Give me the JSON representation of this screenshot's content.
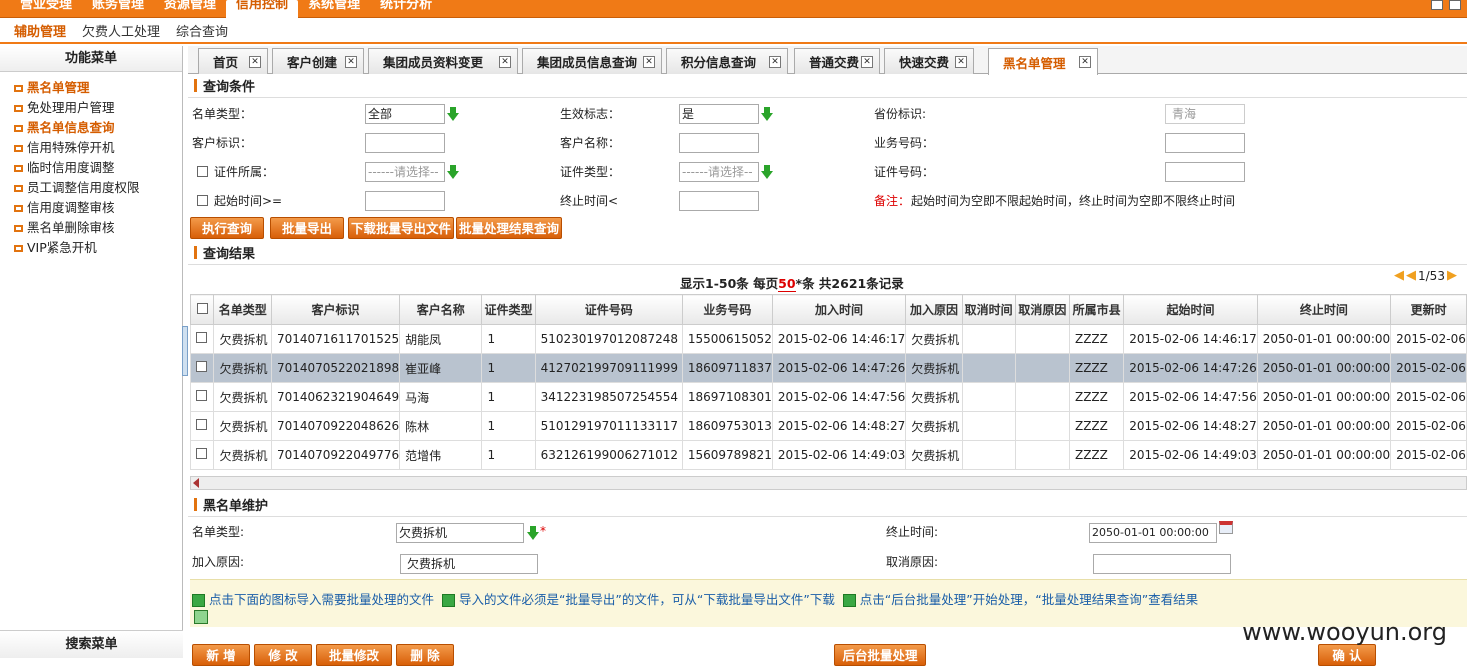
{
  "topnav": [
    "营业受理",
    "账务管理",
    "资源管理",
    "信用控制",
    "系统管理",
    "统计分析"
  ],
  "topnav_active": 3,
  "subnav": [
    "辅助管理",
    "欠费人工处理",
    "综合查询"
  ],
  "sidebar": {
    "header": "功能菜单",
    "items": [
      "黑名单管理",
      "免处理用户管理",
      "黑名单信息查询",
      "信用特殊停开机",
      "临时信用度调整",
      "员工调整信用度权限",
      "信用度调整审核",
      "黑名单删除审核",
      "VIP紧急开机"
    ],
    "footer": "搜索菜单"
  },
  "tabs": [
    "首页",
    "客户创建",
    "集团成员资料变更",
    "集团成员信息查询",
    "积分信息查询",
    "普通交费",
    "快速交费",
    "黑名单管理"
  ],
  "query": {
    "title": "查询条件",
    "name_type_label": "名单类型：",
    "name_type_value": "全部",
    "effect_label": "生效标志：",
    "effect_value": "是",
    "province_label": "省份标识:",
    "province_value": "青海",
    "cust_id_label": "客户标识：",
    "cust_name_label": "客户名称：",
    "biz_no_label": "业务号码：",
    "cert_owner_label": "证件所属：",
    "cert_owner_ph": "------请选择--",
    "cert_type_label": "证件类型：",
    "cert_type_ph": "------请选择--",
    "cert_no_label": "证件号码：",
    "start_label": "起始时间>=",
    "end_label": "终止时间<",
    "note_prefix": "备注：",
    "note_text": "起始时间为空即不限起始时间，终止时间为空即不限终止时间"
  },
  "buttons": {
    "exec": "执行查询",
    "export": "批量导出",
    "download": "下载批量导出文件",
    "result_query": "批量处理结果查询"
  },
  "results": {
    "title": "查询结果",
    "page_info_a": "显示1-50条  每页",
    "page_size": "50",
    "page_info_b": "*条  共2621条记录",
    "page_num": "1/53"
  },
  "columns": [
    "名单类型",
    "客户标识",
    "客户名称",
    "证件类型",
    "证件号码",
    "业务号码",
    "加入时间",
    "加入原因",
    "取消时间",
    "取消原因",
    "所属市县",
    "起始时间",
    "终止时间",
    "更新时"
  ],
  "rows": [
    [
      "欠费拆机",
      "7014071611701525",
      "胡能凤",
      "1",
      "510230197012087248",
      "15500615052",
      "2015-02-06 14:46:17",
      "欠费拆机",
      "",
      "",
      "ZZZZ",
      "2015-02-06 14:46:17",
      "2050-01-01 00:00:00",
      "2015-02-06"
    ],
    [
      "欠费拆机",
      "7014070522021898",
      "崔亚峰",
      "1",
      "412702199709111999",
      "18609711837",
      "2015-02-06 14:47:26",
      "欠费拆机",
      "",
      "",
      "ZZZZ",
      "2015-02-06 14:47:26",
      "2050-01-01 00:00:00",
      "2015-02-06"
    ],
    [
      "欠费拆机",
      "7014062321904649",
      "马海",
      "1",
      "341223198507254554",
      "18697108301",
      "2015-02-06 14:47:56",
      "欠费拆机",
      "",
      "",
      "ZZZZ",
      "2015-02-06 14:47:56",
      "2050-01-01 00:00:00",
      "2015-02-06"
    ],
    [
      "欠费拆机",
      "7014070922048626",
      "陈林",
      "1",
      "510129197011133117",
      "18609753013",
      "2015-02-06 14:48:27",
      "欠费拆机",
      "",
      "",
      "ZZZZ",
      "2015-02-06 14:48:27",
      "2050-01-01 00:00:00",
      "2015-02-06"
    ],
    [
      "欠费拆机",
      "7014070922049776",
      "范增伟",
      "1",
      "632126199006271012",
      "15609789821",
      "2015-02-06 14:49:03",
      "欠费拆机",
      "",
      "",
      "ZZZZ",
      "2015-02-06 14:49:03",
      "2050-01-01 00:00:00",
      "2015-02-06"
    ]
  ],
  "maintain": {
    "title": "黑名单维护",
    "name_type_label": "名单类型:",
    "name_type_value": "欠费拆机",
    "end_label": "终止时间:",
    "end_value": "2050-01-01 00:00:00",
    "reason_label": "加入原因:",
    "reason_value": "欠费拆机",
    "cancel_label": "取消原因:"
  },
  "notes": {
    "n1": "点击下面的图标导入需要批量处理的文件",
    "n2": "导入的文件必须是“批量导出”的文件，可从“下载批量导出文件”下载",
    "n3": "点击“后台批量处理”开始处理，“批量处理结果查询”查看结果"
  },
  "bottom_buttons": [
    "新 增",
    "修 改",
    "批量修改",
    "删 除",
    "后台批量处理",
    "确 认"
  ],
  "watermark": "www.wooyun.org"
}
